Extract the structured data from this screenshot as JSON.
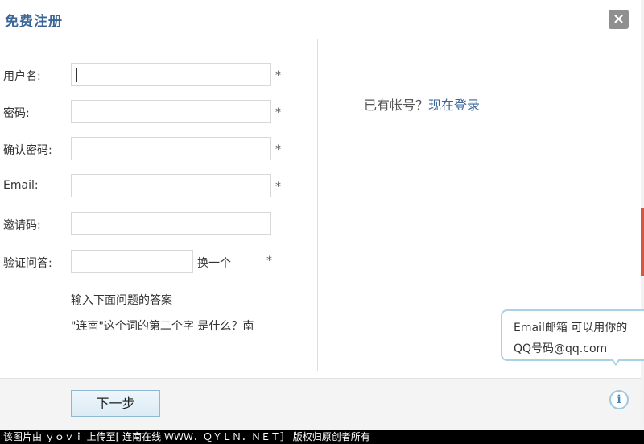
{
  "dialog": {
    "title": "免费注册",
    "close_icon": "close-icon",
    "close_glyph": "×"
  },
  "form": {
    "username_label": "用户名:",
    "password_label": "密码:",
    "confirm_label": "确认密码:",
    "email_label": "Email:",
    "invite_label": "邀请码:",
    "captcha_label": "验证问答:",
    "required_mark": "*",
    "swap_link": "换一个",
    "hint_line1": "输入下面问题的答案",
    "hint_line2": "\"连南\"这个词的第二个字 是什么？南"
  },
  "side": {
    "already_text": "已有帐号？",
    "login_link": "现在登录"
  },
  "tooltip": {
    "line1": "Email邮箱  可以用你的",
    "line2": "QQ号码@qq.com"
  },
  "footer": {
    "next_button": "下一步",
    "info_icon": "info-icon",
    "info_glyph": "i"
  },
  "watermark": {
    "text": "该图片由 ｙｏｖｉ 上传至[ 连南在线 ＷＷＷ．ＱＹＬＮ．ＮＥＴ］ 版权归原创者所有"
  },
  "colors": {
    "title": "#3a6596",
    "link": "#3a6596",
    "close_bg": "#8f8f8f",
    "tooltip_border": "#a9d2e6",
    "button_border": "#8fb8d3"
  }
}
